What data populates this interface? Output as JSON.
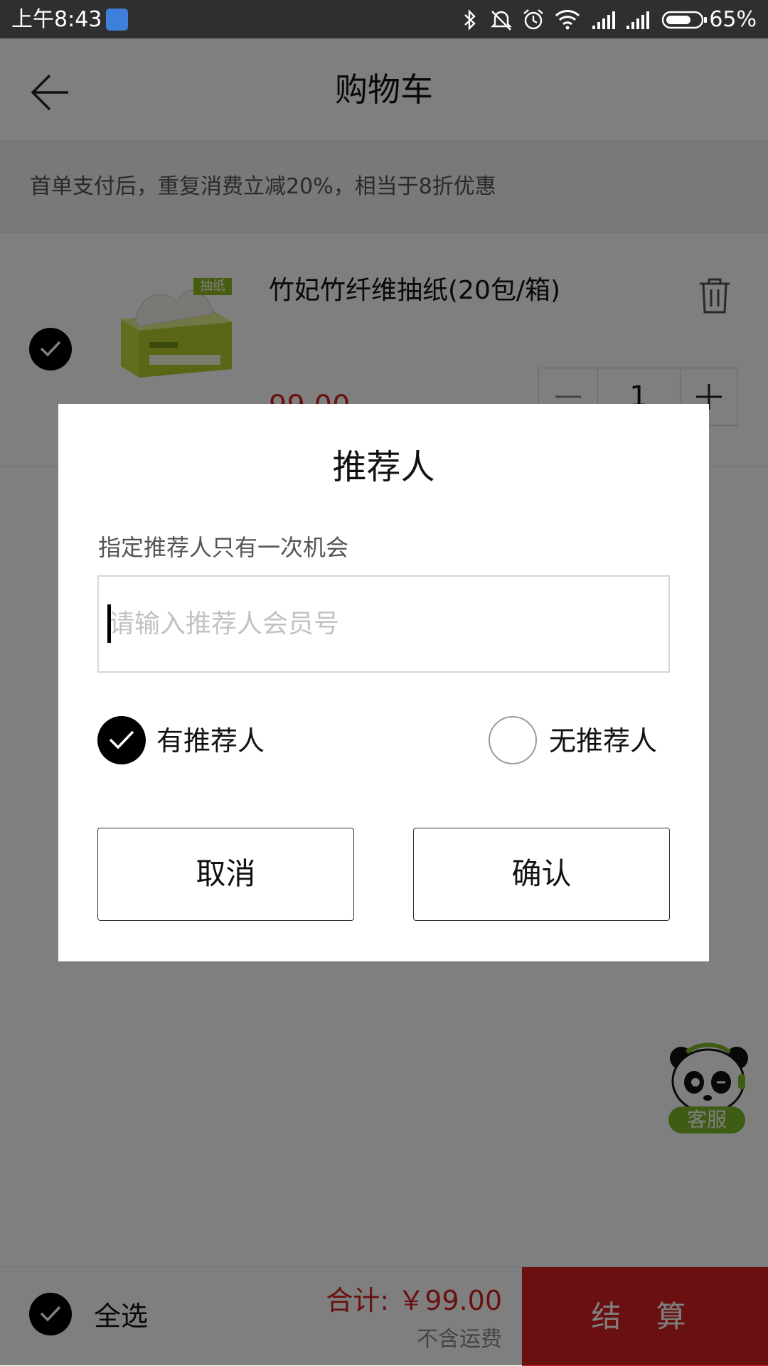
{
  "status_bar": {
    "time": "上午8:43",
    "battery": "65%",
    "icons": [
      "bluetooth-icon",
      "mute-icon",
      "alarm-icon",
      "wifi-icon",
      "signal-icon",
      "signal-icon",
      "battery-icon"
    ]
  },
  "header": {
    "title": "购物车",
    "back_icon": "back-arrow-icon"
  },
  "promo": {
    "text": "首单支付后，重复消费立减20%，相当于8折优惠"
  },
  "cart_item": {
    "badge": "抽纸",
    "name": "竹妃竹纤维抽纸(20包/箱)",
    "price": "99.00",
    "quantity": "1",
    "checked": true
  },
  "dialog": {
    "title": "推荐人",
    "hint": "指定推荐人只有一次机会",
    "input_placeholder": "请输入推荐人会员号",
    "input_value": "",
    "option_yes": "有推荐人",
    "option_no": "无推荐人",
    "selected_option": "yes",
    "cancel_label": "取消",
    "confirm_label": "确认"
  },
  "service": {
    "label": "客服"
  },
  "bottom_bar": {
    "select_all_label": "全选",
    "total": "合计: ￥99.00",
    "shipping_note": "不含运费",
    "checkout_label": "结 算"
  },
  "colors": {
    "accent_red": "#d42020",
    "check_black": "#000000",
    "badge_green": "#8cb81e"
  }
}
